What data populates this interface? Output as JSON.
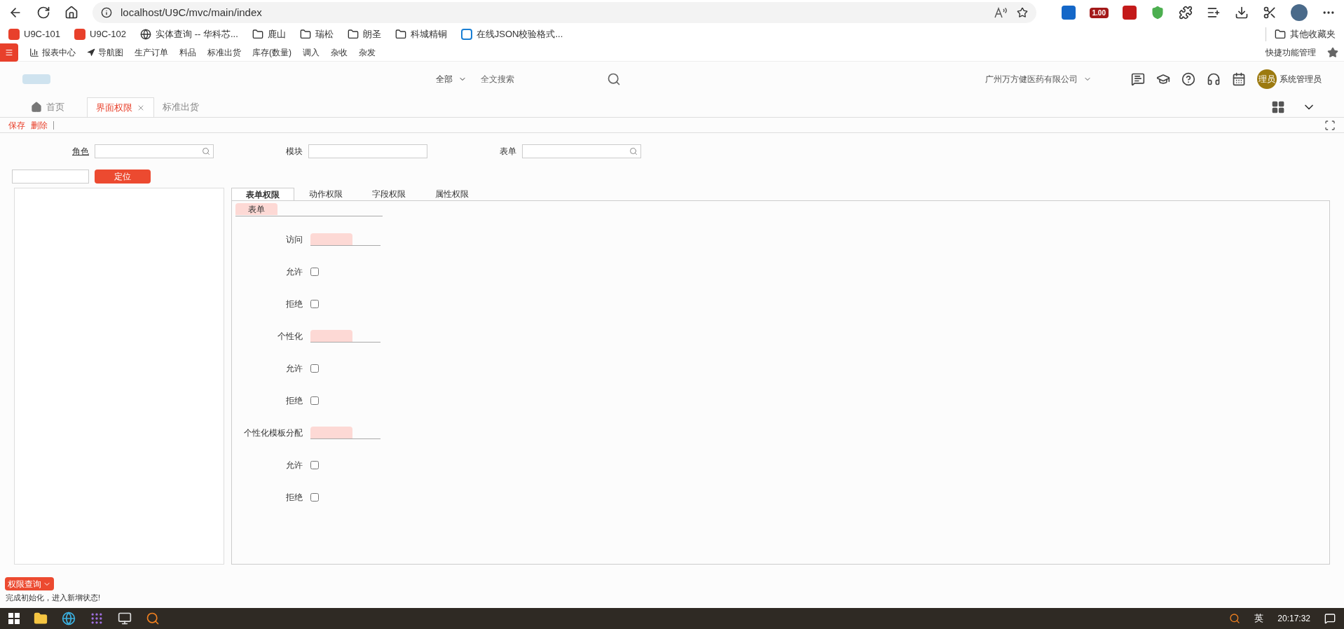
{
  "browser": {
    "url": "localhost/U9C/mvc/main/index",
    "extension_badge": "1.00"
  },
  "bookmarks": [
    {
      "label": "U9C-101",
      "kind": "app"
    },
    {
      "label": "U9C-102",
      "kind": "app"
    },
    {
      "label": "实体查询 -- 华科芯...",
      "kind": "globe"
    },
    {
      "label": "鹿山",
      "kind": "folder"
    },
    {
      "label": "瑞松",
      "kind": "folder"
    },
    {
      "label": "朗圣",
      "kind": "folder"
    },
    {
      "label": "科城精铜",
      "kind": "folder"
    },
    {
      "label": "在线JSON校验格式...",
      "kind": "b"
    }
  ],
  "other_bookmarks": "其他收藏夹",
  "quick_menu": [
    {
      "label": "报表中心",
      "kind": "chart"
    },
    {
      "label": "导航图",
      "kind": "nav"
    },
    {
      "label": "生产订单",
      "kind": "plain"
    },
    {
      "label": "料品",
      "kind": "plain"
    },
    {
      "label": "标准出货",
      "kind": "plain"
    },
    {
      "label": "库存(数量)",
      "kind": "plain"
    },
    {
      "label": "调入",
      "kind": "plain"
    },
    {
      "label": "杂收",
      "kind": "plain"
    },
    {
      "label": "杂发",
      "kind": "plain"
    }
  ],
  "quick_manage": "快捷功能管理",
  "header": {
    "scope": "全部",
    "search_placeholder": "全文搜索",
    "company": "广州万方健医药有限公司",
    "avatar": "理员",
    "user": "系统管理员"
  },
  "page_tabs": [
    {
      "label": "首页",
      "selected": false,
      "kind": "home"
    },
    {
      "label": "界面权限",
      "selected": true,
      "kind": "closable"
    },
    {
      "label": "标准出货",
      "selected": false,
      "kind": "plain"
    }
  ],
  "toolbar": [
    "保存",
    "删除"
  ],
  "filters": [
    {
      "label": "角色",
      "underlined": true,
      "search": true
    },
    {
      "label": "模块",
      "underlined": false,
      "search": false
    },
    {
      "label": "表单",
      "underlined": false,
      "search": true
    }
  ],
  "locate_button": "定位",
  "perm_tabs": [
    {
      "label": "表单权限",
      "selected": true
    },
    {
      "label": "动作权限",
      "selected": false
    },
    {
      "label": "字段权限",
      "selected": false
    },
    {
      "label": "属性权限",
      "selected": false
    }
  ],
  "section": "表单",
  "rows": [
    {
      "kind": "header",
      "label": "访问"
    },
    {
      "kind": "check",
      "label": "允许",
      "checked": false
    },
    {
      "kind": "check",
      "label": "拒绝",
      "checked": false
    },
    {
      "kind": "header",
      "label": "个性化"
    },
    {
      "kind": "check",
      "label": "允许",
      "checked": false
    },
    {
      "kind": "check",
      "label": "拒绝",
      "checked": false
    },
    {
      "kind": "header",
      "label": "个性化模板分配"
    },
    {
      "kind": "check",
      "label": "允许",
      "checked": false
    },
    {
      "kind": "check",
      "label": "拒绝",
      "checked": false
    }
  ],
  "query_button": "权限查询",
  "status": "完成初始化，进入新增状态!",
  "taskbar": {
    "ime": "英",
    "time": "20:17:32"
  }
}
